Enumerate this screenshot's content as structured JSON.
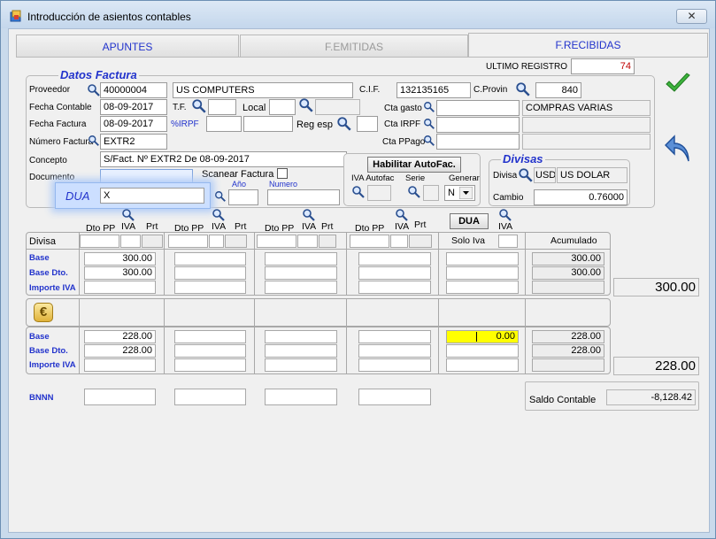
{
  "window": {
    "title": "Introducción de asientos contables",
    "close_glyph": "✕"
  },
  "tabs": [
    {
      "label": "APUNTES",
      "active": false
    },
    {
      "label": "F.EMITIDAS",
      "active": false
    },
    {
      "label": "F.RECIBIDAS",
      "active": true
    }
  ],
  "ultimo_registro": {
    "label": "ULTIMO REGISTRO",
    "value": "74"
  },
  "datos_factura": {
    "legend": "Datos Factura",
    "proveedor": {
      "label": "Proveedor",
      "code": "40000004",
      "name": "US COMPUTERS"
    },
    "cif": {
      "label": "C.I.F.",
      "value": "132135165"
    },
    "c_provin": {
      "label": "C.Provin",
      "value": "840"
    },
    "fecha_contable": {
      "label": "Fecha Contable",
      "value": "08-09-2017"
    },
    "tf": {
      "label": "T.F.",
      "value": ""
    },
    "local": {
      "label": "Local",
      "value": ""
    },
    "cta_gasto": {
      "label": "Cta gasto",
      "value": "",
      "desc": "COMPRAS VARIAS"
    },
    "fecha_factura": {
      "label": "Fecha Factura",
      "value": "08-09-2017"
    },
    "irpf": {
      "label": "%IRPF",
      "value": ""
    },
    "reg_esp": {
      "label": "Reg esp",
      "value": ""
    },
    "cta_irpf": {
      "label": "Cta  IRPF",
      "value": "",
      "desc": ""
    },
    "numero_factura": {
      "label": "Número Factura",
      "value": "EXTR2"
    },
    "cta_ppago": {
      "label": "Cta PPago",
      "value": "",
      "desc": ""
    },
    "concepto": {
      "label": "Concepto",
      "value": "S/Fact. Nº EXTR2 De 08-09-2017"
    },
    "documento": {
      "label": "Documento",
      "value": ""
    },
    "scanear": {
      "label": "Scanear Factura",
      "checked": false
    },
    "dua": {
      "label": "DUA",
      "value": "X",
      "anio_label": "Año",
      "numero_label": "Numero"
    }
  },
  "autofac": {
    "button": "Habilitar AutoFac.",
    "iva_autofac_label": "IVA Autofac",
    "serie_label": "Serie",
    "generar_label": "Generar",
    "generar_value": "N"
  },
  "divisas": {
    "legend": "Divisas",
    "divisa_label": "Divisa",
    "code": "USD",
    "name": "US DOLAR",
    "cambio_label": "Cambio",
    "cambio_value": "0.76000"
  },
  "grid": {
    "col_headers": {
      "dto_pp": "Dto PP",
      "iva": "IVA",
      "prt": "Prt",
      "dua_button": "DUA",
      "solo_iva": "Solo Iva",
      "acumulado": "Acumulado"
    },
    "divisa_label": "Divisa",
    "row_labels_a": [
      "Base",
      "Base Dto.",
      "Importe IVA"
    ],
    "row_labels_b": [
      "Base",
      "Base Dto.",
      "Importe IVA"
    ],
    "bnnn_label": "BNNN",
    "values_a": {
      "base": "300.00",
      "base_dto": "300.00",
      "acum_base": "300.00",
      "acum_base_dto": "300.00"
    },
    "values_b": {
      "base": "228.00",
      "base_dto": "228.00",
      "solo_iva": "0.00",
      "acum_base": "228.00",
      "acum_base_dto": "228.00"
    },
    "total_divisa": "300.00",
    "total_eur": "228.00",
    "euro_glyph": "€"
  },
  "saldo": {
    "label": "Saldo Contable",
    "value": "-8,128.42"
  },
  "icons": {
    "confirm": "check-icon",
    "back": "back-arrow-icon",
    "search": "magnifier-icon"
  },
  "colors": {
    "accent_blue": "#2233cc",
    "check_green": "#3db33d",
    "highlight_yellow": "#ffff00",
    "counter_red": "#c00000"
  }
}
